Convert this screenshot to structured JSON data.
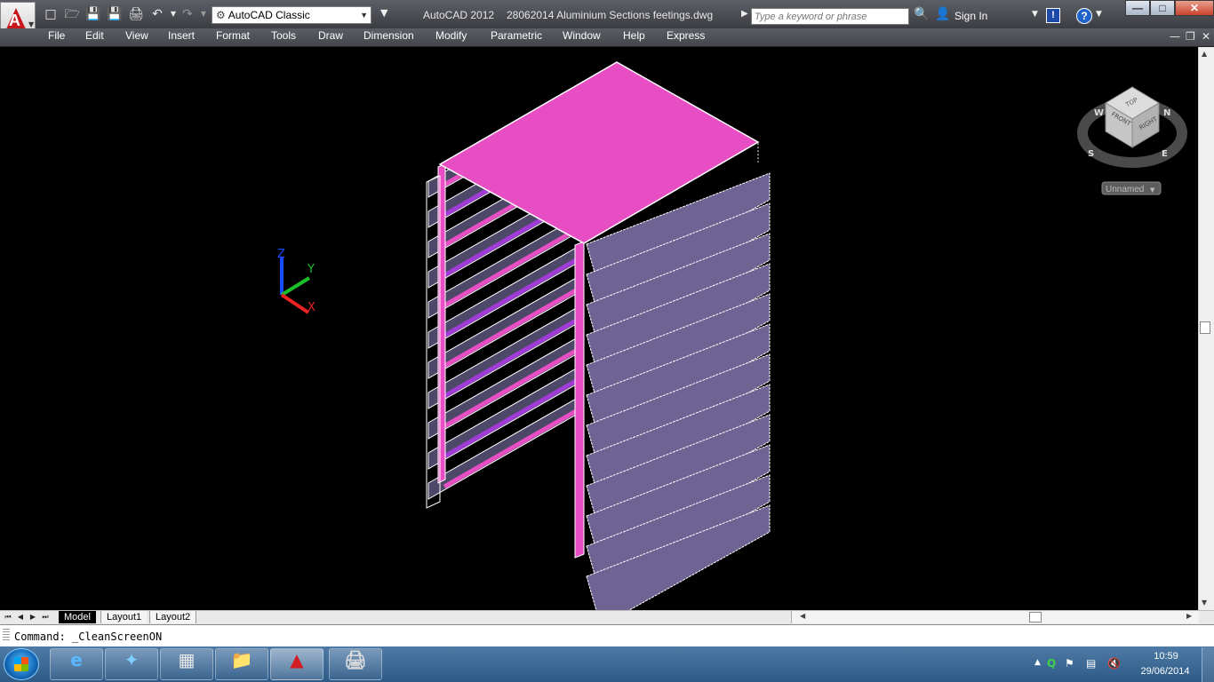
{
  "titlebar": {
    "workspace": "AutoCAD Classic",
    "app_name": "AutoCAD 2012",
    "document_name": "28062014 Aluminium Sections feetings.dwg",
    "search_placeholder": "Type a keyword or phrase",
    "sign_in": "Sign In",
    "app_logo_letter": "A"
  },
  "menubar": {
    "items": [
      "File",
      "Edit",
      "View",
      "Insert",
      "Format",
      "Tools",
      "Draw",
      "Dimension",
      "Modify",
      "Parametric",
      "Window",
      "Help",
      "Express"
    ]
  },
  "viewcube": {
    "faces": {
      "top": "TOP",
      "front": "FRONT",
      "right": "RIGHT"
    },
    "compass": {
      "n": "N",
      "w": "W",
      "s": "S",
      "e": "E"
    },
    "ucs_menu": "Unnamed"
  },
  "ucs_icon": {
    "x": "X",
    "y": "Y",
    "z": "Z"
  },
  "layout_tabs": [
    "Model",
    "Layout1",
    "Layout2"
  ],
  "command_line": {
    "text": "Command: _CleanScreenON"
  },
  "taskbar": {
    "time": "10:59",
    "date": "29/06/2014"
  },
  "colors": {
    "top_face": "#e84ec4",
    "right_louver": "#6f6393",
    "left_louver_dark": "#4d4868",
    "left_louver_accent": "#a03bd6",
    "frame_post": "#e84ec4",
    "edge": "#ffffff"
  },
  "icons": [
    "new-icon",
    "open-icon",
    "save-icon",
    "saveas-icon",
    "print-icon",
    "undo-icon",
    "redo-icon",
    "binoculars-icon",
    "user-icon",
    "exchange-icon",
    "help-icon"
  ]
}
